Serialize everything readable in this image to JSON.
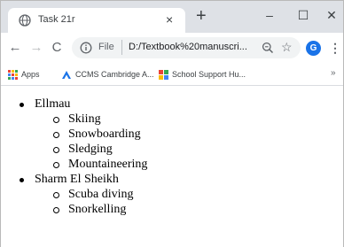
{
  "browser": {
    "tab": {
      "title": "Task 21r",
      "favicon": "globe-icon"
    },
    "window_controls": {
      "minimize": "–",
      "maximize": "☐",
      "close": "✕"
    },
    "new_tab_label": "+",
    "tab_close_label": "×",
    "address": {
      "scheme_label": "File",
      "url": "D:/Textbook%20manuscri..."
    },
    "profile_initial": "G",
    "bookmarks": [
      {
        "label": "Apps",
        "icon": "apps-grid-icon"
      },
      {
        "label": "CCMS Cambridge A...",
        "icon": "cambridge-logo-icon"
      },
      {
        "label": "School Support Hu...",
        "icon": "school-support-icon"
      }
    ],
    "bookmarks_more": "»",
    "colors": {
      "profile": "#1a73e8",
      "tabstrip": "#dee1e6"
    }
  },
  "page": {
    "list": [
      {
        "label": "Ellmau",
        "items": [
          "Skiing",
          "Snowboarding",
          "Sledging",
          "Mountaineering"
        ]
      },
      {
        "label": "Sharm El Sheikh",
        "items": [
          "Scuba diving",
          "Snorkelling"
        ]
      }
    ]
  }
}
